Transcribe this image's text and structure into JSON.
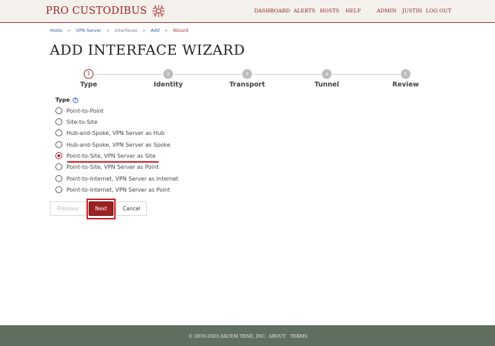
{
  "header": {
    "logo_text": "PRO CUSTODIBUS",
    "nav": {
      "dashboard": "DASHBOARD",
      "alerts": "ALERTS",
      "hosts": "HOSTS",
      "help": "HELP",
      "admin": "ADMIN",
      "user": "JUSTIN",
      "logout": "LOG OUT"
    }
  },
  "breadcrumb": {
    "hosts": "Hosts",
    "vpn_server": "VPN Server",
    "interfaces": "Interfaces",
    "add": "Add",
    "wizard": "Wizard",
    "separator": ">"
  },
  "page_title": "ADD INTERFACE WIZARD",
  "stepper": {
    "active_step": 1,
    "steps": [
      {
        "number": "1",
        "label": "Type"
      },
      {
        "number": "2",
        "label": "Identity"
      },
      {
        "number": "3",
        "label": "Transport"
      },
      {
        "number": "4",
        "label": "Tunnel"
      },
      {
        "number": "5",
        "label": "Review"
      }
    ]
  },
  "form": {
    "type_label": "Type",
    "help_icon_glyph": "?",
    "selected_index": 4,
    "options": [
      "Point-to-Point",
      "Site-to-Site",
      "Hub-and-Spoke, VPN Server as Hub",
      "Hub-and-Spoke, VPN Server as Spoke",
      "Point-to-Site, VPN Server as Site",
      "Point-to-Site, VPN Server as Point",
      "Point-to-Internet, VPN Server as Internet",
      "Point-to-Internet, VPN Server as Point"
    ]
  },
  "buttons": {
    "previous": "Previous",
    "next": "Next",
    "cancel": "Cancel"
  },
  "footer": {
    "copyright": "© 2019-2023 ARCEM TENE, INC.",
    "about": "ABOUT",
    "terms": "TERMS"
  },
  "colors": {
    "brand": "#9b2123",
    "highlight": "#d0141c",
    "footer_bg": "#607060"
  }
}
